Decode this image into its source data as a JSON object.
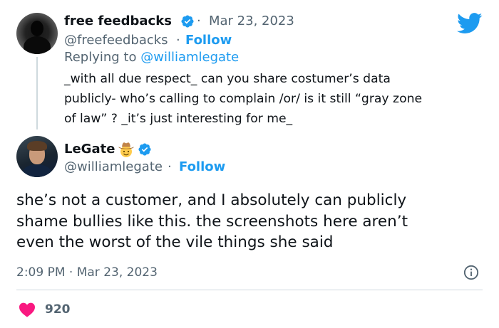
{
  "reply_tweet": {
    "author_name": "free feedbacks",
    "dot": "·",
    "date": "Mar 23, 2023",
    "handle": "@freefeedbacks",
    "follow_label": "Follow",
    "replying_prefix": "Replying to",
    "replying_to": "@williamlegate",
    "text_lines": [
      "_with all due respect_ can you share costumer’s data",
      "publicly-  who’s calling to complain /or/ is it still “gray zone",
      "of law” ?  _it’s just interesting for me_"
    ]
  },
  "main_tweet": {
    "author_name": "LeGate",
    "handle": "@williamlegate",
    "dot": "·",
    "follow_label": "Follow",
    "text_lines": [
      "she’s not a customer, and I absolutely can publicly",
      "shame bullies like this. the screenshots here aren’t",
      "even the worst of the vile things she said"
    ],
    "timestamp": "2:09 PM · Mar 23, 2023",
    "like_count": "920"
  },
  "colors": {
    "twitter_blue": "#1d9bf0",
    "secondary_text": "#536471",
    "heart_red": "#f91880",
    "verified_blue": "#1d9bf0"
  },
  "icons": [
    "twitter-bird-icon",
    "verified-badge-icon",
    "cowboy-hat-emoji-icon",
    "info-icon",
    "heart-icon"
  ]
}
